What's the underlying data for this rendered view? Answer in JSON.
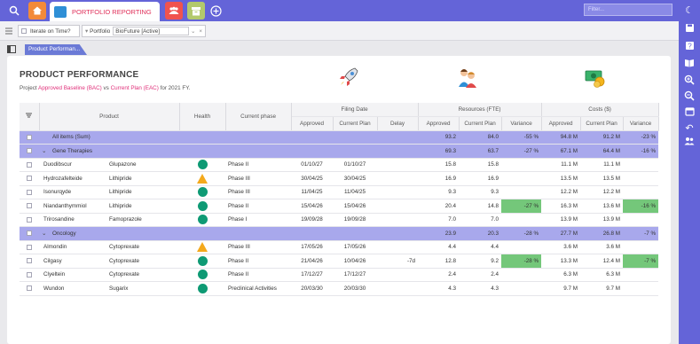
{
  "app": {
    "tab_title": "PORTFOLIO REPORTING",
    "filter_placeholder": "Filter...",
    "view_tab": "Product Performan..."
  },
  "toolbar": {
    "iterate_label": "Iterate on Time?",
    "portfolio_label": "Portfolio",
    "portfolio_value": "BioFuture [Active]"
  },
  "report": {
    "title": "PRODUCT PERFORMANCE",
    "subtitle_project": "Project",
    "subtitle_baseline": "Approved Baseline (BAC)",
    "subtitle_vs": "vs",
    "subtitle_current": "Current Plan (EAC)",
    "subtitle_year": "for 2021 FY."
  },
  "columns": {
    "product": "Product",
    "health": "Health",
    "current_phase": "Current phase",
    "filing_date": "Filing Date",
    "resources": "Resources (FTE)",
    "costs": "Costs ($)",
    "approved": "Approved",
    "current_plan": "Current Plan",
    "delay": "Delay",
    "variance": "Variance"
  },
  "rows": [
    {
      "type": "group",
      "expand": "",
      "name": "All items (Sum)",
      "res_approved": "93.2",
      "res_current": "84.0",
      "res_variance": "-55 %",
      "cost_approved": "94.8 M",
      "cost_current": "91.2 M",
      "cost_variance": "-23 %"
    },
    {
      "type": "group",
      "expand": "⌄",
      "name": "Gene Therapies",
      "res_approved": "69.3",
      "res_current": "63.7",
      "res_variance": "-27 %",
      "cost_approved": "67.1 M",
      "cost_current": "64.4 M",
      "cost_variance": "-16 %"
    },
    {
      "type": "item",
      "name": "Duodibscur",
      "compound": "Glupazone",
      "health": "green",
      "phase": "Phase II",
      "filing_approved": "01/10/27",
      "filing_current": "01/10/27",
      "delay": "",
      "res_approved": "15.8",
      "res_current": "15.8",
      "res_variance": "",
      "res_hl": false,
      "cost_approved": "11.1 M",
      "cost_current": "11.1 M",
      "cost_variance": "",
      "cost_hl": false
    },
    {
      "type": "item",
      "name": "Hydrozafelteide",
      "compound": "Lithipride",
      "health": "amber",
      "phase": "Phase III",
      "filing_approved": "30/04/25",
      "filing_current": "30/04/25",
      "delay": "",
      "res_approved": "16.9",
      "res_current": "16.9",
      "res_variance": "",
      "res_hl": false,
      "cost_approved": "13.5 M",
      "cost_current": "13.5 M",
      "cost_variance": "",
      "cost_hl": false
    },
    {
      "type": "item",
      "name": "Isonurqyde",
      "compound": "Lithipride",
      "health": "green",
      "phase": "Phase III",
      "filing_approved": "11/04/25",
      "filing_current": "11/04/25",
      "delay": "",
      "res_approved": "9.3",
      "res_current": "9.3",
      "res_variance": "",
      "res_hl": false,
      "cost_approved": "12.2 M",
      "cost_current": "12.2 M",
      "cost_variance": "",
      "cost_hl": false
    },
    {
      "type": "item",
      "name": "Niandanthymmiol",
      "compound": "Lithipride",
      "health": "green",
      "phase": "Phase II",
      "filing_approved": "15/04/26",
      "filing_current": "15/04/26",
      "delay": "",
      "res_approved": "20.4",
      "res_current": "14.8",
      "res_variance": "-27 %",
      "res_hl": true,
      "cost_approved": "16.3 M",
      "cost_current": "13.6 M",
      "cost_variance": "-16 %",
      "cost_hl": true
    },
    {
      "type": "item",
      "name": "Trirosandine",
      "compound": "Famoprazole",
      "health": "green",
      "phase": "Phase I",
      "filing_approved": "19/09/28",
      "filing_current": "19/09/28",
      "delay": "",
      "res_approved": "7.0",
      "res_current": "7.0",
      "res_variance": "",
      "res_hl": false,
      "cost_approved": "13.9 M",
      "cost_current": "13.9 M",
      "cost_variance": "",
      "cost_hl": false
    },
    {
      "type": "group",
      "expand": "⌄",
      "name": "Oncology",
      "res_approved": "23.9",
      "res_current": "20.3",
      "res_variance": "-28 %",
      "cost_approved": "27.7 M",
      "cost_current": "26.8 M",
      "cost_variance": "-7 %"
    },
    {
      "type": "item",
      "name": "Almondin",
      "compound": "Cytoprexate",
      "health": "amber",
      "phase": "Phase III",
      "filing_approved": "17/05/26",
      "filing_current": "17/05/26",
      "delay": "",
      "res_approved": "4.4",
      "res_current": "4.4",
      "res_variance": "",
      "res_hl": false,
      "cost_approved": "3.6 M",
      "cost_current": "3.6 M",
      "cost_variance": "",
      "cost_hl": false
    },
    {
      "type": "item",
      "name": "Cilgasy",
      "compound": "Cytoprexate",
      "health": "green",
      "phase": "Phase II",
      "filing_approved": "21/04/26",
      "filing_current": "10/04/26",
      "delay": "-7d",
      "res_approved": "12.8",
      "res_current": "9.2",
      "res_variance": "-28 %",
      "res_hl": true,
      "cost_approved": "13.3 M",
      "cost_current": "12.4 M",
      "cost_variance": "-7 %",
      "cost_hl": true
    },
    {
      "type": "item",
      "name": "Clyeltein",
      "compound": "Cytoprexate",
      "health": "green",
      "phase": "Phase II",
      "filing_approved": "17/12/27",
      "filing_current": "17/12/27",
      "delay": "",
      "res_approved": "2.4",
      "res_current": "2.4",
      "res_variance": "",
      "res_hl": false,
      "cost_approved": "6.3 M",
      "cost_current": "6.3 M",
      "cost_variance": "",
      "cost_hl": false
    },
    {
      "type": "item",
      "name": "Wundon",
      "compound": "Sugarix",
      "health": "green",
      "phase": "Preclinical Activities",
      "filing_approved": "20/03/30",
      "filing_current": "20/03/30",
      "delay": "",
      "res_approved": "4.3",
      "res_current": "4.3",
      "res_variance": "",
      "res_hl": false,
      "cost_approved": "9.7 M",
      "cost_current": "9.7 M",
      "cost_variance": "",
      "cost_hl": false
    }
  ],
  "colors": {
    "accent": "#6464d8",
    "group_row": "#a8a8ec",
    "highlight": "#74c77a",
    "health_green": "#0e9a74",
    "health_amber": "#f4a91c",
    "brand_pink": "#e0305a"
  },
  "icons": {
    "top": [
      "search-icon",
      "home-icon",
      "portfolio-icon",
      "team-icon",
      "archive-icon",
      "add-icon"
    ],
    "right": [
      "moon-icon",
      "save-icon",
      "help-icon",
      "book-icon",
      "zoom-in-icon",
      "zoom-out-icon",
      "calendar-icon",
      "undo-icon",
      "users-icon"
    ],
    "header": [
      "rocket-icon",
      "team-icon",
      "money-icon"
    ]
  }
}
